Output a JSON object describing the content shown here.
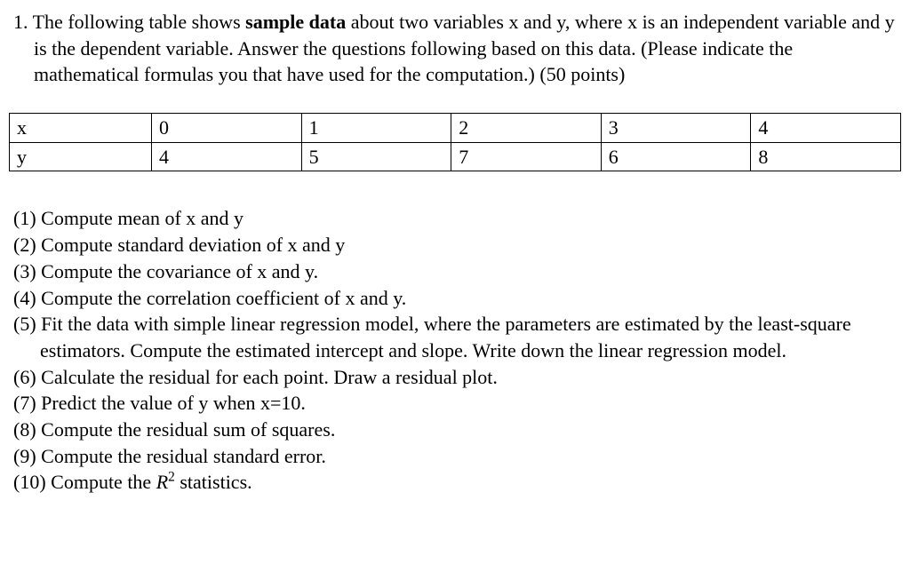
{
  "question": {
    "number": "1.",
    "intro_part1": "The following table shows ",
    "intro_bold": "sample data",
    "intro_part2": " about two variables x and y, where x is an independent variable and y is the dependent variable. Answer the questions following based on this data. (Please indicate the mathematical formulas you that have used for the computation.)  (50 points)"
  },
  "table": {
    "row_x_label": "x",
    "row_x_values": [
      "0",
      "1",
      "2",
      "3",
      "4"
    ],
    "row_y_label": "y",
    "row_y_values": [
      "4",
      "5",
      "7",
      "6",
      "8"
    ]
  },
  "subquestions": {
    "q1": "(1) Compute mean of x and y",
    "q2": "(2) Compute standard deviation of x and y",
    "q3": "(3) Compute  the covariance of x and y.",
    "q4": "(4) Compute the correlation coefficient of x and y.",
    "q5": "(5) Fit the data with simple linear regression model, where the parameters are estimated by the least-square estimators.  Compute the estimated intercept and slope.  Write down the linear regression model.",
    "q6": "(6)  Calculate the residual for each point. Draw a residual plot.",
    "q7": "(7) Predict the value of y when x=10.",
    "q8": "(8) Compute the residual sum of squares.",
    "q9": "(9)  Compute the residual standard error.",
    "q10_prefix": "(10) Compute the ",
    "q10_var": "R",
    "q10_sup": "2",
    "q10_suffix": " statistics."
  }
}
